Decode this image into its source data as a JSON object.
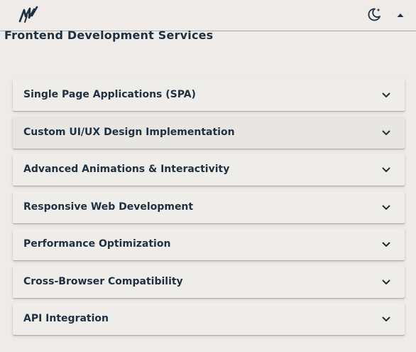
{
  "header": {
    "logo_icon": "brand-logo-mw",
    "theme_toggle_icon": "moon-star-icon",
    "collapse_icon": "caret-up-icon"
  },
  "page": {
    "title": "Frontend Development Services"
  },
  "accordion": {
    "items": [
      {
        "label": "Single Page Applications (SPA)"
      },
      {
        "label": "Custom UI/UX Design Implementation"
      },
      {
        "label": "Advanced Animations & Interactivity"
      },
      {
        "label": "Responsive Web Development"
      },
      {
        "label": "Performance Optimization"
      },
      {
        "label": "Cross-Browser Compatibility"
      },
      {
        "label": "API Integration"
      }
    ],
    "expand_icon": "chevron-down-icon"
  },
  "colors": {
    "background": "#eeebe8",
    "text": "#1f3140",
    "panel": "#efedea"
  }
}
